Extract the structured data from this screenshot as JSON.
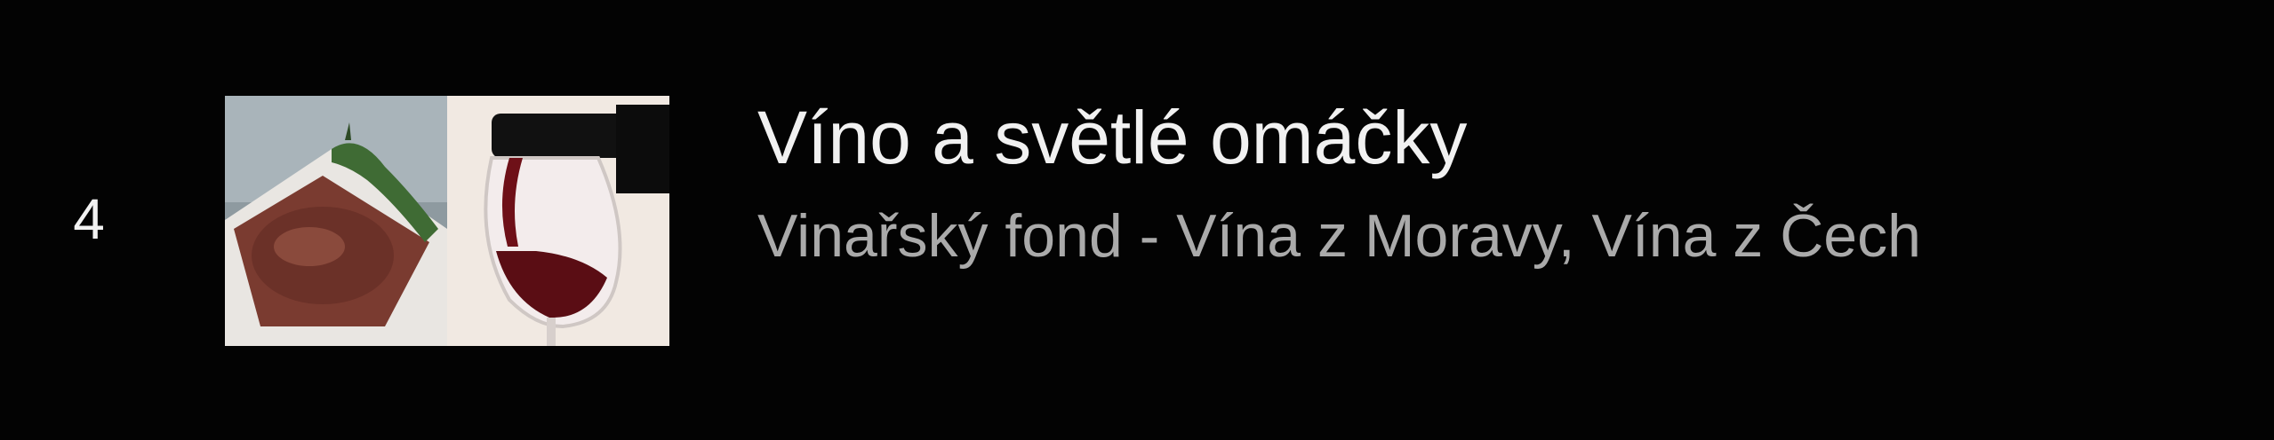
{
  "playlist_item": {
    "index": "4",
    "title": "Víno a světlé omáčky",
    "channel": "Vinařský fond - Vína z Moravy, Vína z Čech",
    "thumbnail_icon": "wine-and-dish-thumbnail"
  },
  "colors": {
    "background": "#000000",
    "title_text": "#f1f1f1",
    "subtitle_text": "#aaaaaa",
    "index_text": "#f2f2f2"
  }
}
